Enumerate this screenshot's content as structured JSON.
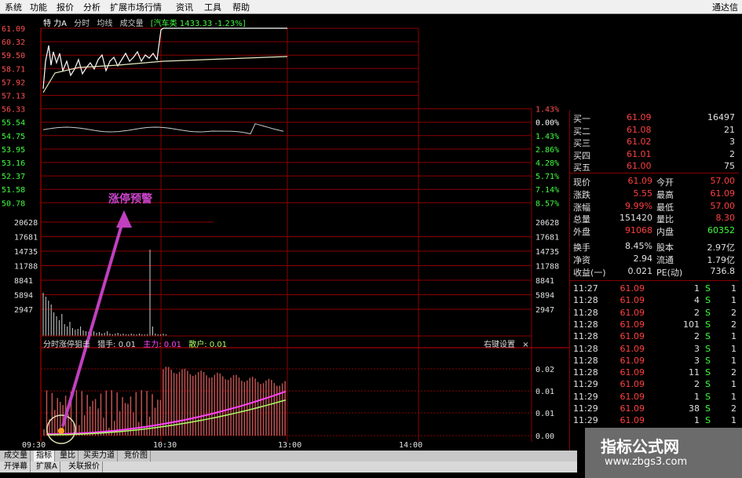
{
  "menubar": {
    "items": [
      "系统",
      "功能",
      "报价",
      "分析",
      "扩展市场行情",
      "资讯",
      "工具",
      "帮助"
    ],
    "title": "通达信"
  },
  "chart_header": {
    "stock_name": "特 力A",
    "period": "分时",
    "avg_label": "均线",
    "vol_label": "成交量",
    "index_info": "[汽车类 1433.33 -1.23%]"
  },
  "price_axis": {
    "left": [
      "61.09",
      "60.32",
      "59.50",
      "58.71",
      "57.92",
      "57.13",
      "56.33",
      "55.54",
      "54.75",
      "53.95",
      "53.16",
      "52.37",
      "51.58",
      "50.78"
    ],
    "right": [
      "",
      "",
      "",
      "",
      "",
      "",
      "1.43%",
      "0.00%",
      "1.43%",
      "2.86%",
      "4.28%",
      "5.71%",
      "7.14%",
      "8.57%"
    ]
  },
  "volume_axis": [
    "20628",
    "17681",
    "14735",
    "11788",
    "8841",
    "5894",
    "2947"
  ],
  "indicator": {
    "title": "分时涨停狙击",
    "series": [
      {
        "label": "猎手: 0.01",
        "color": "#dddddd"
      },
      {
        "label": "主力: 0.01",
        "color": "#ff44ff"
      },
      {
        "label": "散户: 0.01",
        "color": "#aaff66"
      }
    ],
    "settings": "右键设置",
    "close": "×",
    "axis": [
      "0.02",
      "0.01",
      "0.01",
      "0.00"
    ]
  },
  "annotation": {
    "text": "涨停预警",
    "color": "#cc44cc"
  },
  "time_axis": [
    "09:30",
    "10:30",
    "13:00",
    "14:00"
  ],
  "quote": {
    "bids": [
      {
        "label": "买一",
        "price": "61.09",
        "vol": "16497"
      },
      {
        "label": "买二",
        "price": "61.08",
        "vol": "21"
      },
      {
        "label": "买三",
        "price": "61.02",
        "vol": "3"
      },
      {
        "label": "买四",
        "price": "61.01",
        "vol": "2"
      },
      {
        "label": "买五",
        "price": "61.00",
        "vol": "75"
      }
    ],
    "stats": [
      {
        "l1": "现价",
        "v1": "61.09",
        "l2": "今开",
        "v2": "57.00",
        "c1": "#ff4040",
        "c2": "#ff4040"
      },
      {
        "l1": "涨跌",
        "v1": "5.55",
        "l2": "最高",
        "v2": "61.09",
        "c1": "#ff4040",
        "c2": "#ff4040"
      },
      {
        "l1": "涨幅",
        "v1": "9.99%",
        "l2": "最低",
        "v2": "57.00",
        "c1": "#ff4040",
        "c2": "#ff4040"
      },
      {
        "l1": "总量",
        "v1": "151420",
        "l2": "量比",
        "v2": "8.30",
        "c1": "#e0e0e0",
        "c2": "#ff4040"
      },
      {
        "l1": "外盘",
        "v1": "91068",
        "l2": "内盘",
        "v2": "60352",
        "c1": "#ff4040",
        "c2": "#40ff40"
      },
      {
        "l1": "换手",
        "v1": "8.45%",
        "l2": "股本",
        "v2": "2.97亿",
        "c1": "#e0e0e0",
        "c2": "#e0e0e0"
      },
      {
        "l1": "净资",
        "v1": "2.94",
        "l2": "流通",
        "v2": "1.79亿",
        "c1": "#e0e0e0",
        "c2": "#e0e0e0"
      },
      {
        "l1": "收益(一)",
        "v1": "0.021",
        "l2": "PE(动)",
        "v2": "736.8",
        "c1": "#e0e0e0",
        "c2": "#e0e0e0"
      }
    ],
    "ticks": [
      {
        "time": "11:27",
        "price": "61.09",
        "vol": "1",
        "dir": "S",
        "n": "1"
      },
      {
        "time": "11:28",
        "price": "61.09",
        "vol": "4",
        "dir": "S",
        "n": "1"
      },
      {
        "time": "11:28",
        "price": "61.09",
        "vol": "2",
        "dir": "S",
        "n": "2"
      },
      {
        "time": "11:28",
        "price": "61.09",
        "vol": "101",
        "dir": "S",
        "n": "2"
      },
      {
        "time": "11:28",
        "price": "61.09",
        "vol": "2",
        "dir": "S",
        "n": "1"
      },
      {
        "time": "11:28",
        "price": "61.09",
        "vol": "3",
        "dir": "S",
        "n": "1"
      },
      {
        "time": "11:28",
        "price": "61.09",
        "vol": "3",
        "dir": "S",
        "n": "1"
      },
      {
        "time": "11:28",
        "price": "61.09",
        "vol": "11",
        "dir": "S",
        "n": "2"
      },
      {
        "time": "11:29",
        "price": "61.09",
        "vol": "2",
        "dir": "S",
        "n": "1"
      },
      {
        "time": "11:29",
        "price": "61.09",
        "vol": "1",
        "dir": "S",
        "n": "1"
      },
      {
        "time": "11:29",
        "price": "61.09",
        "vol": "38",
        "dir": "S",
        "n": "2"
      },
      {
        "time": "11:29",
        "price": "61.09",
        "vol": "1",
        "dir": "S",
        "n": "1"
      }
    ]
  },
  "bottom_tabs": [
    "成交量",
    "指标",
    "量比",
    "买卖力道",
    "竞价图"
  ],
  "bottom_tabs2": [
    "开弹幕",
    "扩展A",
    "关联报价"
  ],
  "watermark": {
    "line1": "指标公式网",
    "line2": "www.zbgs3.com"
  },
  "colors": {
    "grid": "#8b0000",
    "price_line": "#ffffff",
    "avg_line": "#ffff66",
    "up": "#ff4040",
    "down": "#40ff40"
  }
}
